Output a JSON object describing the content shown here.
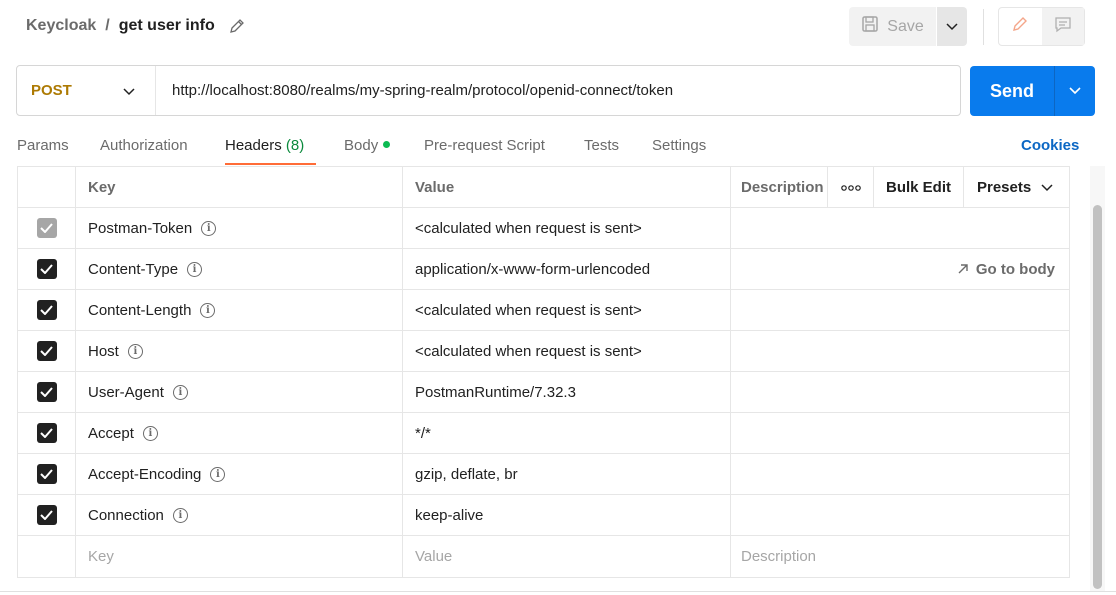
{
  "breadcrumb": {
    "parent": "Keycloak",
    "separator": "/",
    "current": "get user info"
  },
  "toolbar": {
    "save_label": "Save"
  },
  "request": {
    "method": "POST",
    "url": "http://localhost:8080/realms/my-spring-realm/protocol/openid-connect/token",
    "send_label": "Send"
  },
  "tabs": [
    {
      "label": "Params"
    },
    {
      "label": "Authorization"
    },
    {
      "label": "Headers",
      "count": "(8)",
      "active": true
    },
    {
      "label": "Body",
      "indicator": "green-dot"
    },
    {
      "label": "Pre-request Script"
    },
    {
      "label": "Tests"
    },
    {
      "label": "Settings"
    }
  ],
  "cookies_label": "Cookies",
  "table": {
    "headers": {
      "key": "Key",
      "value": "Value",
      "description": "Description",
      "bulk_edit": "Bulk Edit",
      "presets": "Presets"
    },
    "rows": [
      {
        "key": "Postman-Token",
        "value": "<calculated when request is sent>",
        "checked": true,
        "disabled": true
      },
      {
        "key": "Content-Type",
        "value": "application/x-www-form-urlencoded",
        "checked": true,
        "action": "Go to body"
      },
      {
        "key": "Content-Length",
        "value": "<calculated when request is sent>",
        "checked": true
      },
      {
        "key": "Host",
        "value": "<calculated when request is sent>",
        "checked": true
      },
      {
        "key": "User-Agent",
        "value": "PostmanRuntime/7.32.3",
        "checked": true
      },
      {
        "key": "Accept",
        "value": "*/*",
        "checked": true
      },
      {
        "key": "Accept-Encoding",
        "value": "gzip, deflate, br",
        "checked": true
      },
      {
        "key": "Connection",
        "value": "keep-alive",
        "checked": true
      }
    ],
    "placeholders": {
      "key": "Key",
      "value": "Value",
      "description": "Description"
    }
  },
  "colors": {
    "accent": "#ff6c37",
    "send": "#097bed",
    "method": "#ad7a03",
    "count": "#0b8a3c",
    "link": "#0b67c4"
  }
}
